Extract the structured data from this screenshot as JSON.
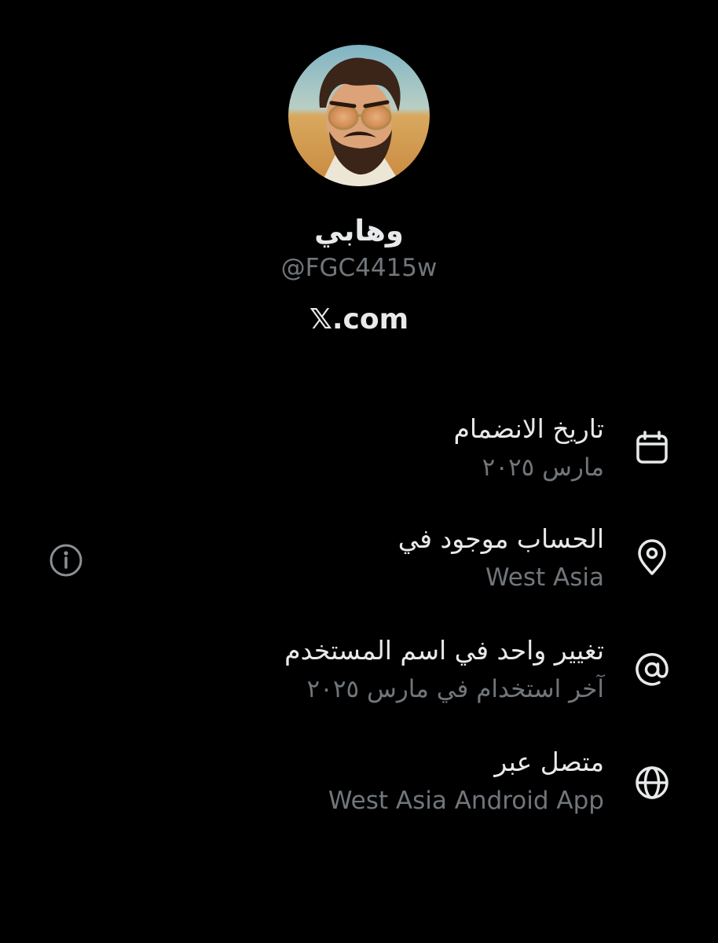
{
  "profile": {
    "display_name": "وهابي",
    "handle": "@FGC4415w",
    "site": "𝕏.com",
    "avatar_icon": "avatar-illustration"
  },
  "about": {
    "joined": {
      "label": "تاريخ الانضمام",
      "value": "مارس ٢٠٢٥",
      "icon": "calendar-icon"
    },
    "location": {
      "label": "الحساب موجود في",
      "value": "West Asia",
      "icon": "location-pin-icon",
      "info_icon": "info-icon"
    },
    "username_changes": {
      "label": "تغيير واحد في اسم المستخدم",
      "value": "آخر استخدام في مارس ٢٠٢٥",
      "icon": "at-sign-icon"
    },
    "connected_via": {
      "label": "متصل عبر",
      "value": "West Asia Android App",
      "icon": "globe-icon"
    }
  },
  "colors": {
    "background": "#000000",
    "primary_text": "#e7e9ea",
    "secondary_text": "#71767b"
  }
}
